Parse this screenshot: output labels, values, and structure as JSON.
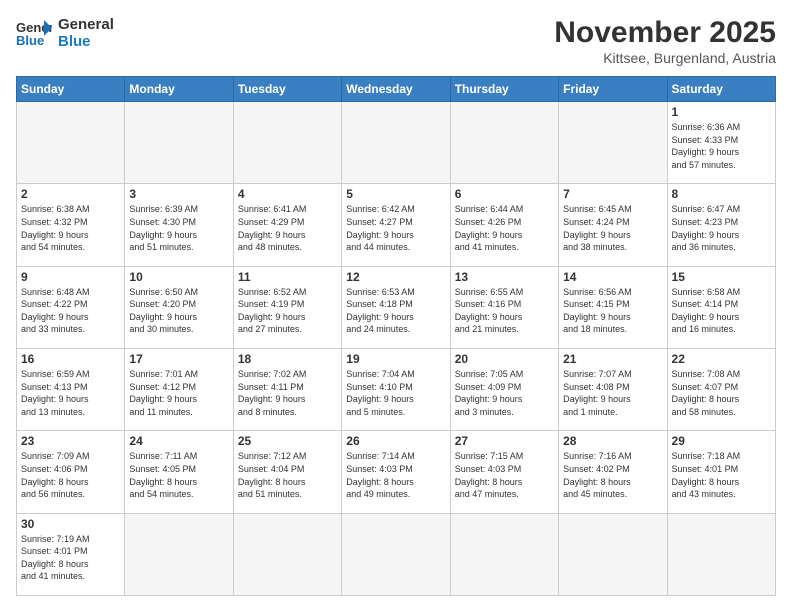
{
  "logo": {
    "general": "General",
    "blue": "Blue"
  },
  "header": {
    "month": "November 2025",
    "location": "Kittsee, Burgenland, Austria"
  },
  "weekdays": [
    "Sunday",
    "Monday",
    "Tuesday",
    "Wednesday",
    "Thursday",
    "Friday",
    "Saturday"
  ],
  "days": [
    {
      "num": "",
      "info": ""
    },
    {
      "num": "",
      "info": ""
    },
    {
      "num": "",
      "info": ""
    },
    {
      "num": "",
      "info": ""
    },
    {
      "num": "",
      "info": ""
    },
    {
      "num": "",
      "info": ""
    },
    {
      "num": "1",
      "info": "Sunrise: 6:36 AM\nSunset: 4:33 PM\nDaylight: 9 hours\nand 57 minutes."
    },
    {
      "num": "2",
      "info": "Sunrise: 6:38 AM\nSunset: 4:32 PM\nDaylight: 9 hours\nand 54 minutes."
    },
    {
      "num": "3",
      "info": "Sunrise: 6:39 AM\nSunset: 4:30 PM\nDaylight: 9 hours\nand 51 minutes."
    },
    {
      "num": "4",
      "info": "Sunrise: 6:41 AM\nSunset: 4:29 PM\nDaylight: 9 hours\nand 48 minutes."
    },
    {
      "num": "5",
      "info": "Sunrise: 6:42 AM\nSunset: 4:27 PM\nDaylight: 9 hours\nand 44 minutes."
    },
    {
      "num": "6",
      "info": "Sunrise: 6:44 AM\nSunset: 4:26 PM\nDaylight: 9 hours\nand 41 minutes."
    },
    {
      "num": "7",
      "info": "Sunrise: 6:45 AM\nSunset: 4:24 PM\nDaylight: 9 hours\nand 38 minutes."
    },
    {
      "num": "8",
      "info": "Sunrise: 6:47 AM\nSunset: 4:23 PM\nDaylight: 9 hours\nand 36 minutes."
    },
    {
      "num": "9",
      "info": "Sunrise: 6:48 AM\nSunset: 4:22 PM\nDaylight: 9 hours\nand 33 minutes."
    },
    {
      "num": "10",
      "info": "Sunrise: 6:50 AM\nSunset: 4:20 PM\nDaylight: 9 hours\nand 30 minutes."
    },
    {
      "num": "11",
      "info": "Sunrise: 6:52 AM\nSunset: 4:19 PM\nDaylight: 9 hours\nand 27 minutes."
    },
    {
      "num": "12",
      "info": "Sunrise: 6:53 AM\nSunset: 4:18 PM\nDaylight: 9 hours\nand 24 minutes."
    },
    {
      "num": "13",
      "info": "Sunrise: 6:55 AM\nSunset: 4:16 PM\nDaylight: 9 hours\nand 21 minutes."
    },
    {
      "num": "14",
      "info": "Sunrise: 6:56 AM\nSunset: 4:15 PM\nDaylight: 9 hours\nand 18 minutes."
    },
    {
      "num": "15",
      "info": "Sunrise: 6:58 AM\nSunset: 4:14 PM\nDaylight: 9 hours\nand 16 minutes."
    },
    {
      "num": "16",
      "info": "Sunrise: 6:59 AM\nSunset: 4:13 PM\nDaylight: 9 hours\nand 13 minutes."
    },
    {
      "num": "17",
      "info": "Sunrise: 7:01 AM\nSunset: 4:12 PM\nDaylight: 9 hours\nand 11 minutes."
    },
    {
      "num": "18",
      "info": "Sunrise: 7:02 AM\nSunset: 4:11 PM\nDaylight: 9 hours\nand 8 minutes."
    },
    {
      "num": "19",
      "info": "Sunrise: 7:04 AM\nSunset: 4:10 PM\nDaylight: 9 hours\nand 5 minutes."
    },
    {
      "num": "20",
      "info": "Sunrise: 7:05 AM\nSunset: 4:09 PM\nDaylight: 9 hours\nand 3 minutes."
    },
    {
      "num": "21",
      "info": "Sunrise: 7:07 AM\nSunset: 4:08 PM\nDaylight: 9 hours\nand 1 minute."
    },
    {
      "num": "22",
      "info": "Sunrise: 7:08 AM\nSunset: 4:07 PM\nDaylight: 8 hours\nand 58 minutes."
    },
    {
      "num": "23",
      "info": "Sunrise: 7:09 AM\nSunset: 4:06 PM\nDaylight: 8 hours\nand 56 minutes."
    },
    {
      "num": "24",
      "info": "Sunrise: 7:11 AM\nSunset: 4:05 PM\nDaylight: 8 hours\nand 54 minutes."
    },
    {
      "num": "25",
      "info": "Sunrise: 7:12 AM\nSunset: 4:04 PM\nDaylight: 8 hours\nand 51 minutes."
    },
    {
      "num": "26",
      "info": "Sunrise: 7:14 AM\nSunset: 4:03 PM\nDaylight: 8 hours\nand 49 minutes."
    },
    {
      "num": "27",
      "info": "Sunrise: 7:15 AM\nSunset: 4:03 PM\nDaylight: 8 hours\nand 47 minutes."
    },
    {
      "num": "28",
      "info": "Sunrise: 7:16 AM\nSunset: 4:02 PM\nDaylight: 8 hours\nand 45 minutes."
    },
    {
      "num": "29",
      "info": "Sunrise: 7:18 AM\nSunset: 4:01 PM\nDaylight: 8 hours\nand 43 minutes."
    },
    {
      "num": "30",
      "info": "Sunrise: 7:19 AM\nSunset: 4:01 PM\nDaylight: 8 hours\nand 41 minutes."
    }
  ]
}
